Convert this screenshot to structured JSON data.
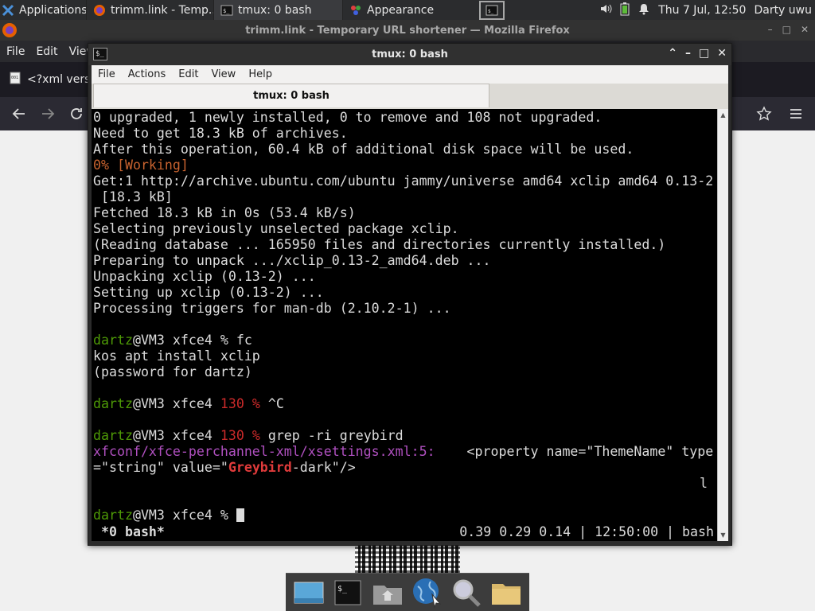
{
  "panel": {
    "apps_label": "Applications",
    "tasks": [
      {
        "label": "trimm.link - Temp..."
      },
      {
        "label": "tmux: 0 bash"
      },
      {
        "label": "Appearance"
      }
    ],
    "clock": "Thu  7 Jul, 12:50",
    "user": "Darty uwu"
  },
  "firefox": {
    "title": "trimm.link - Temporary URL shortener — Mozilla Firefox",
    "menu": [
      "File",
      "Edit",
      "View"
    ],
    "tab_label": "<?xml versi"
  },
  "terminal": {
    "title": "tmux: 0 bash",
    "menu": [
      "File",
      "Actions",
      "Edit",
      "View",
      "Help"
    ],
    "tab_label": "tmux: 0 bash",
    "lines": [
      "0 upgraded, 1 newly installed, 0 to remove and 108 not upgraded.",
      "Need to get 18.3 kB of archives.",
      "After this operation, 60.4 kB of additional disk space will be used.",
      "0% [Working]",
      "Get:1 http://archive.ubuntu.com/ubuntu jammy/universe amd64 xclip amd64 0.13-2",
      " [18.3 kB]",
      "Fetched 18.3 kB in 0s (53.4 kB/s)",
      "Selecting previously unselected package xclip.",
      "(Reading database ... 165950 files and directories currently installed.)",
      "Preparing to unpack .../xclip_0.13-2_amd64.deb ...",
      "Unpacking xclip (0.13-2) ...",
      "Setting up xclip (0.13-2) ...",
      "Processing triggers for man-db (2.10.2-1) ...",
      "",
      "kos apt install xclip",
      "(password for dartz)",
      "",
      "",
      "=\"string\" value=\"",
      "-dark\"/>",
      "l"
    ],
    "prompt_user": "dartz",
    "prompt_host": "@VM3 xfce4 ",
    "prompt_pct": "% ",
    "exit_code": "130",
    "exit_pct": " % ",
    "cmd_fc": "fc",
    "cmd_ctrlc": "^C",
    "cmd_grep": "grep -ri greybird",
    "grep_file": "xfconf/xfce-perchannel-xml/xsettings.xml:5:",
    "grep_property": "    <property name=\"ThemeName\" type",
    "grep_match": "Greybird",
    "status_left": " *0 bash*",
    "status_right": "0.39 0.29 0.14 | 12:50:00 | bash"
  }
}
